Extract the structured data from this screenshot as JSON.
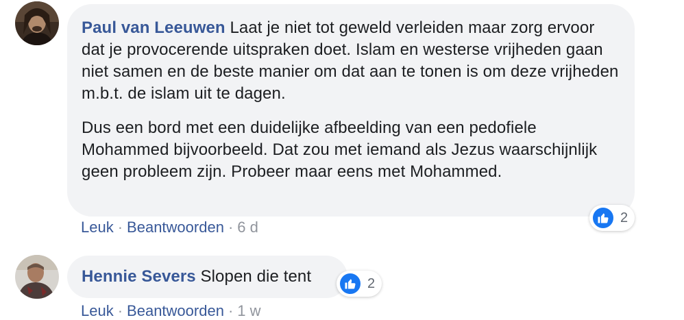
{
  "comments": [
    {
      "author": "Paul van Leeuwen",
      "paragraphs": [
        "Laat je niet tot geweld verleiden maar zorg ervoor dat je provocerende uitspraken doet. Islam en westerse vrijheden gaan niet samen en de beste manier om dat aan te tonen is om deze vrijheden m.b.t. de islam uit te dagen.",
        "Dus een bord met een duidelijke afbeelding van een pedofiele Mohammed bijvoorbeeld. Dat zou met iemand als Jezus waarschijnlijk geen probleem zijn. Probeer maar eens met Mohammed."
      ],
      "reaction_icon": "like-icon",
      "reaction_count": "2",
      "like_label": "Leuk",
      "reply_label": "Beantwoorden",
      "separator": "·",
      "time": "6 d"
    },
    {
      "author": "Hennie Severs",
      "text": "Slopen die tent",
      "reaction_icon": "like-icon",
      "reaction_count": "2",
      "like_label": "Leuk",
      "reply_label": "Beantwoorden",
      "separator": "·",
      "time": "1 w"
    }
  ],
  "colors": {
    "author": "#385898",
    "bubble": "#f2f3f5",
    "like": "#1877f2",
    "meta": "#90949c"
  }
}
